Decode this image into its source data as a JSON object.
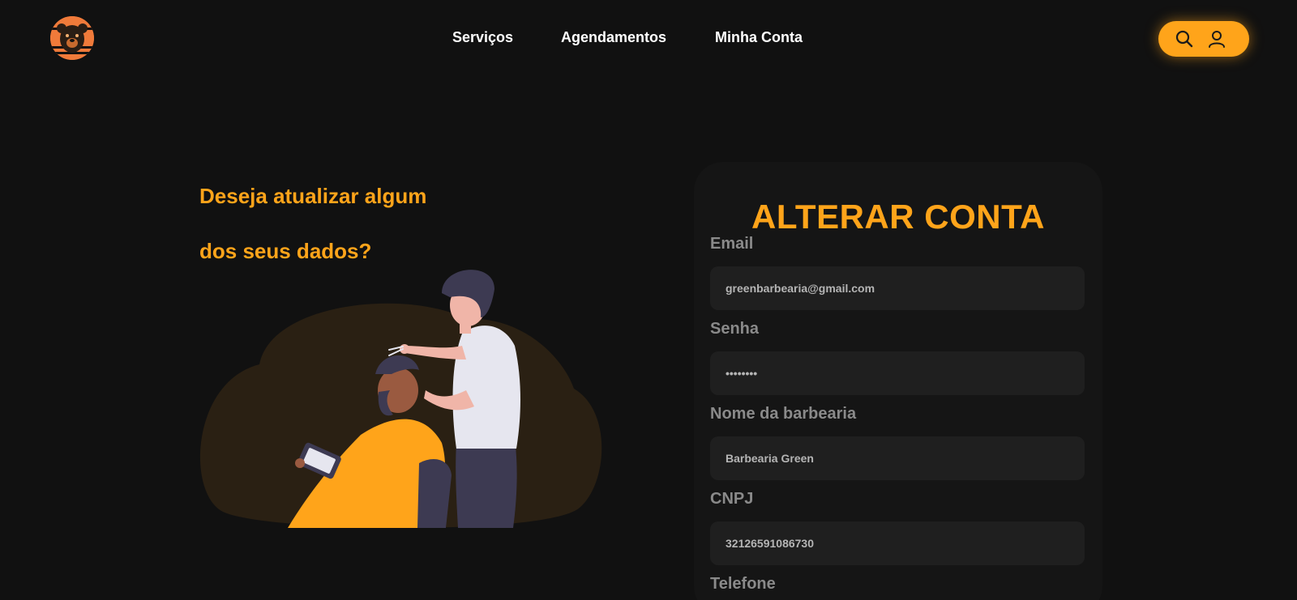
{
  "nav": {
    "items": [
      "Serviços",
      "Agendamentos",
      "Minha Conta"
    ]
  },
  "header": {
    "logo_icon": "bear-logo-icon",
    "search_icon": "search-icon",
    "user_icon": "user-icon",
    "accent_color": "#ffa41a"
  },
  "hero": {
    "line1": "Deseja atualizar algum",
    "line2": "dos seus dados?",
    "illustration": "barber-cutting-hair-illustration"
  },
  "form": {
    "title": "ALTERAR CONTA",
    "fields": [
      {
        "label": "Email",
        "value": "greenbarbearia@gmail.com"
      },
      {
        "label": "Senha",
        "value": "••••••••"
      },
      {
        "label": "Nome da barbearia",
        "value": "Barbearia Green"
      },
      {
        "label": "CNPJ",
        "value": "32126591086730"
      },
      {
        "label": "Telefone",
        "value": ""
      }
    ]
  }
}
